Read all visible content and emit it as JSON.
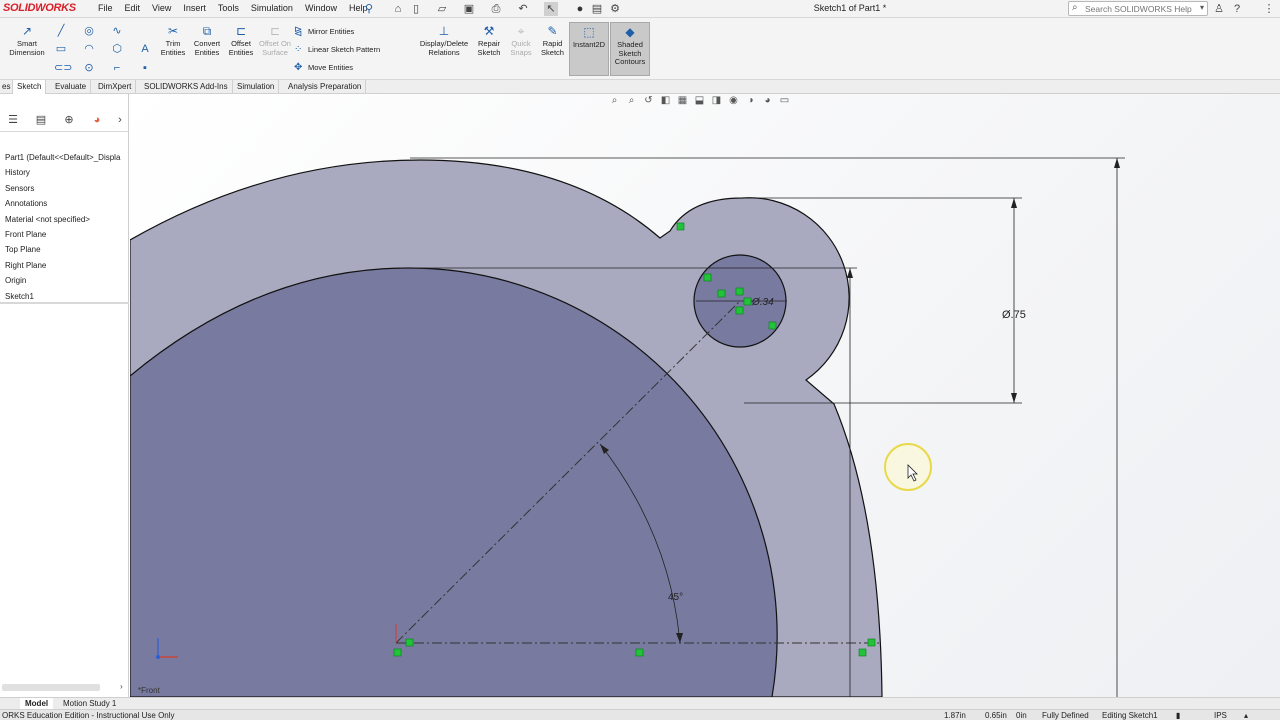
{
  "app": {
    "logo_text": "SOLIDWORKS",
    "document_title": "Sketch1 of Part1 *",
    "menus": [
      "File",
      "Edit",
      "View",
      "Insert",
      "Tools",
      "Simulation",
      "Window",
      "Help"
    ],
    "search_placeholder": "Search SOLIDWORKS Help"
  },
  "ribbon": {
    "smart_dimension": "Smart Dimension",
    "trim_entities": "Trim Entities",
    "convert_entities": "Convert Entities",
    "offset_entities": "Offset Entities",
    "offset_on_surface": "Offset On Surface",
    "mirror_entities": "Mirror Entities",
    "linear_sketch_pattern": "Linear Sketch Pattern",
    "move_entities": "Move Entities",
    "display_delete_relations": "Display/Delete Relations",
    "repair_sketch": "Repair Sketch",
    "quick_snaps": "Quick Snaps",
    "rapid_sketch": "Rapid Sketch",
    "instant2d": "Instant2D",
    "shaded_sketch_contours": "Shaded Sketch Contours"
  },
  "tabs": {
    "cut_prefix": "es",
    "items": [
      "Sketch",
      "Evaluate",
      "DimXpert",
      "SOLIDWORKS Add-Ins",
      "Simulation",
      "Analysis Preparation"
    ],
    "active": "Sketch"
  },
  "feature_tree": {
    "root": "Part1  (Default<<Default>_Displa",
    "items": [
      "History",
      "Sensors",
      "Annotations",
      "Material <not specified>",
      "Front Plane",
      "Top Plane",
      "Right Plane",
      "Origin",
      "Sketch1"
    ]
  },
  "graphics": {
    "view_label": "*Front",
    "dim_small_circle": "Ø.34",
    "dim_large_circle": "Ø.75",
    "dim_angle": "45°"
  },
  "bottom_tabs": [
    "Model",
    "Motion Study 1"
  ],
  "status": {
    "edition": "ORKS Education Edition - Instructional Use Only",
    "x": "1.87in",
    "y": "0.65in",
    "z": "0in",
    "state": "Fully Defined",
    "editing": "Editing Sketch1",
    "units": "IPS"
  },
  "colors": {
    "body_fill": "#a9aabf",
    "inner_fill": "#787aa0",
    "relation_green": "#22c33a",
    "logo_red": "#d8202a"
  }
}
